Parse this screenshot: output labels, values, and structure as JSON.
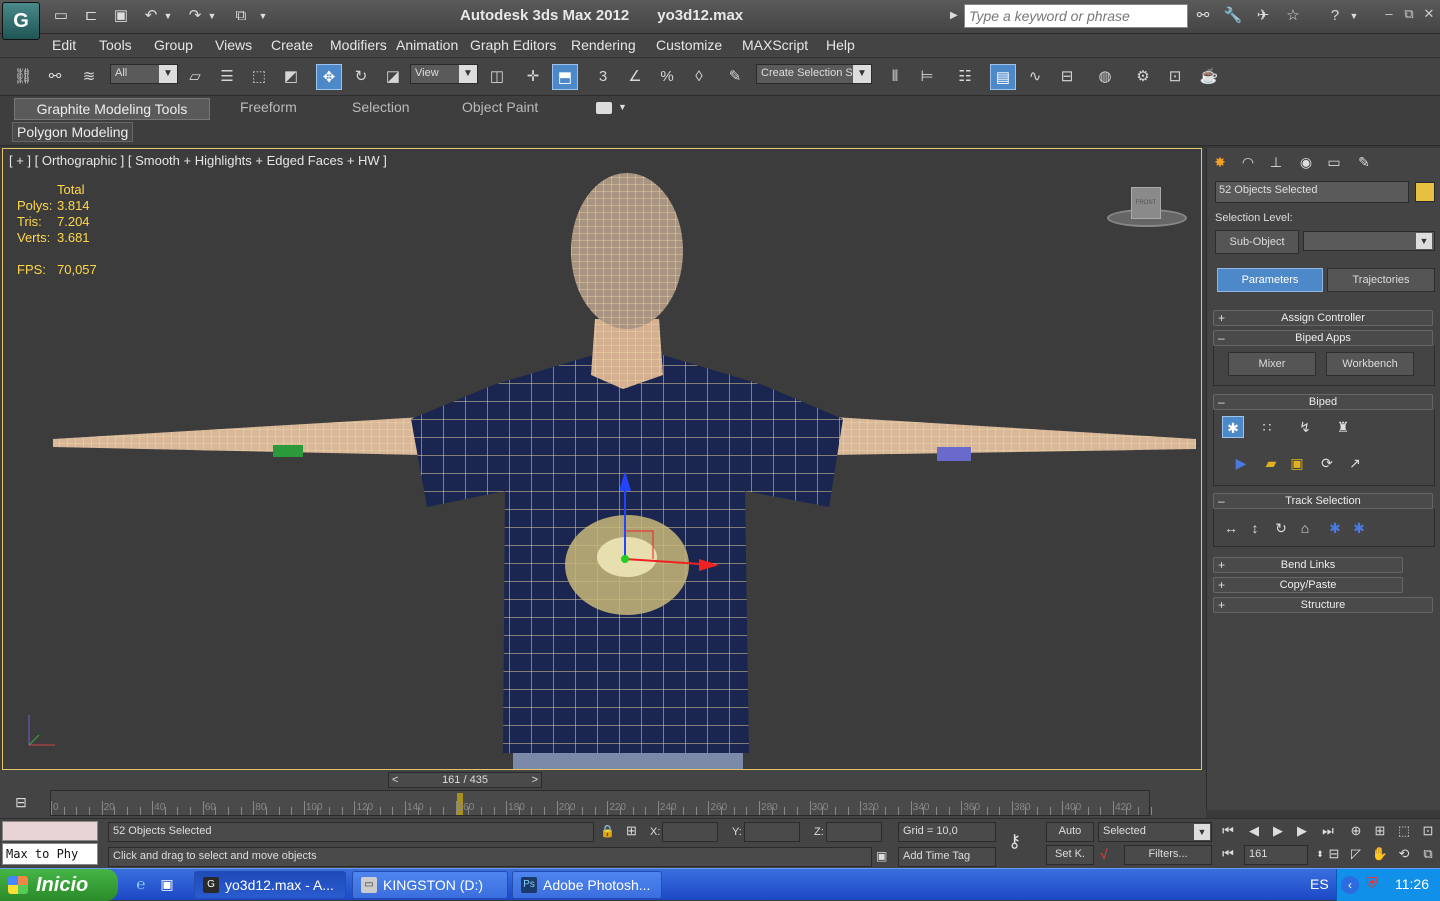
{
  "app": {
    "logo": "G",
    "name": "Autodesk 3ds Max  2012",
    "file": "yo3d12.max",
    "search_placeholder": "Type a keyword or phrase"
  },
  "menu": [
    "Edit",
    "Tools",
    "Group",
    "Views",
    "Create",
    "Modifiers",
    "Animation",
    "Graph Editors",
    "Rendering",
    "Customize",
    "MAXScript",
    "Help"
  ],
  "toolbar": {
    "filter": "All",
    "ref_coord": "View",
    "selection_set": "Create Selection S"
  },
  "ribbon": {
    "tabs": [
      "Graphite Modeling Tools",
      "Freeform",
      "Selection",
      "Object Paint"
    ],
    "panel": "Polygon Modeling"
  },
  "viewport": {
    "label": "[ + ] [ Orthographic ] [ Smooth + Highlights + Edged Faces + HW ]",
    "stats_header": "Total",
    "polys_label": "Polys:",
    "polys_value": "3.814",
    "tris_label": "Tris:",
    "tris_value": "7.204",
    "verts_label": "Verts:",
    "verts_value": "3.681",
    "fps_label": "FPS:",
    "fps_value": "70,057",
    "viewcube": "FRONT"
  },
  "command_panel": {
    "selection_name": "52 Objects Selected",
    "selection_level_label": "Selection Level:",
    "sub_object": "Sub-Object",
    "tabs": [
      "Parameters",
      "Trajectories"
    ],
    "rollouts": {
      "assign_controller": "Assign Controller",
      "biped_apps": "Biped Apps",
      "mixer": "Mixer",
      "workbench": "Workbench",
      "biped": "Biped",
      "track_selection": "Track Selection",
      "bend_links": "Bend Links",
      "copy_paste": "Copy/Paste",
      "structure": "Structure"
    },
    "plus": "+",
    "minus": "–"
  },
  "timeline": {
    "slider": "161 / 435",
    "prev": "<",
    "next": ">",
    "ticks": [
      "0",
      "20",
      "40",
      "60",
      "80",
      "100",
      "120",
      "140",
      "160",
      "180",
      "200",
      "220",
      "240",
      "260",
      "280",
      "300",
      "320",
      "340",
      "360",
      "380",
      "400",
      "420"
    ]
  },
  "status": {
    "script_label": "Max to Phy",
    "selection": "52 Objects Selected",
    "prompt": "Click and drag to select and move objects",
    "x_label": "X:",
    "y_label": "Y:",
    "z_label": "Z:",
    "grid": "Grid = 10,0",
    "add_time_tag": "Add Time Tag",
    "auto_key": "Auto",
    "set_key": "Set K.",
    "key_mode": "Selected",
    "filters": "Filters...",
    "current_frame": "161"
  },
  "taskbar": {
    "start": "Inicio",
    "tasks": [
      "yo3d12.max - A...",
      "KINGSTON (D:)",
      "Adobe Photosh..."
    ],
    "lang": "ES",
    "clock": "11:26",
    "ps_icon": "Ps"
  }
}
